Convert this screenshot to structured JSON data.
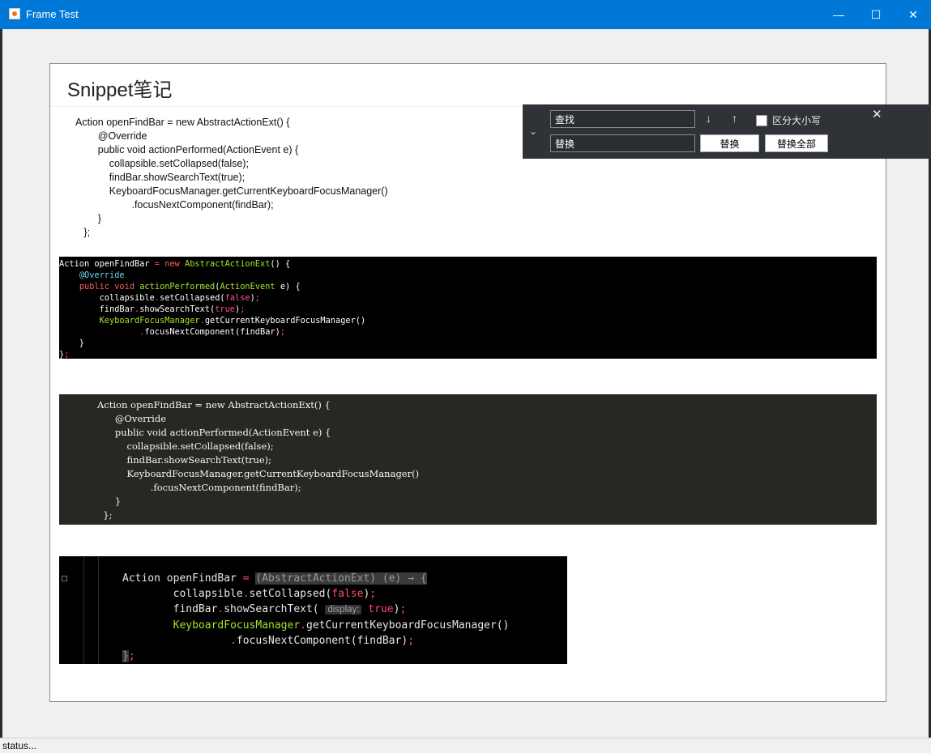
{
  "window": {
    "title": "Frame Test",
    "min_icon": "minimize-icon",
    "max_icon": "maximize-icon",
    "close_icon": "close-icon"
  },
  "editor": {
    "heading": "Snippet笔记"
  },
  "snippets": {
    "plain": [
      "Action openFindBar = new AbstractActionExt() {",
      "@Override",
      "public void actionPerformed(ActionEvent e) {",
      "collapsible.setCollapsed(false);",
      "findBar.showSearchText(true);",
      "KeyboardFocusManager.getCurrentKeyboardFocusManager()",
      ".focusNextComponent(findBar);",
      "}",
      "};"
    ]
  },
  "find_bar": {
    "find_value": "查找",
    "replace_value": "替换",
    "case_label": "区分大小写",
    "replace_button": "替换",
    "replace_all_button": "替换全部",
    "down_arrow": "↓",
    "up_arrow": "↑",
    "close_glyph": "✕",
    "collapse_glyph": "⌄"
  },
  "status": {
    "text": "status..."
  },
  "colors": {
    "titlebar": "#0078d7",
    "find_bar_bg": "#2f3338",
    "monokai_bg": "#272822",
    "keyword_red": "#ff4b6a",
    "function_green": "#a6e22e",
    "annotation_blue": "#66d9ef"
  }
}
